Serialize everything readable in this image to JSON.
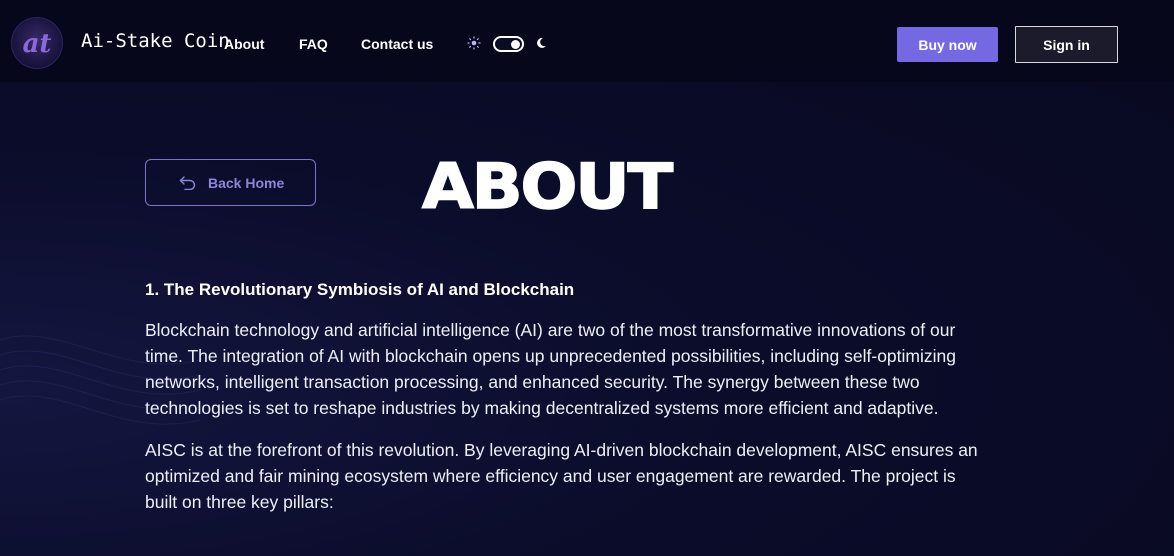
{
  "brand": {
    "name": "Ai-Stake Coin",
    "logo_monogram": "at"
  },
  "nav": {
    "items": [
      {
        "label": "About"
      },
      {
        "label": "FAQ"
      },
      {
        "label": "Contact us"
      }
    ]
  },
  "theme": {
    "mode": "dark",
    "sun_icon": "sun-icon",
    "moon_icon": "moon-icon"
  },
  "header_actions": {
    "buy_label": "Buy now",
    "signin_label": "Sign in"
  },
  "colors": {
    "accent": "#7469e2",
    "background": "#0a0b24",
    "header": "#06071a",
    "back_button_border": "#7b74c9"
  },
  "back": {
    "label": "Back Home",
    "icon": "undo-arrow-icon"
  },
  "page_title": "ABOUT",
  "section": {
    "heading": "1. The Revolutionary Symbiosis of AI and Blockchain",
    "paragraphs": [
      "Blockchain technology and artificial intelligence (AI) are two of the most transformative innovations of our time. The integration of AI with blockchain opens up unprecedented possibilities, including self-optimizing networks, intelligent transaction processing, and enhanced security. The synergy between these two technologies is set to reshape industries by making decentralized systems more efficient and adaptive.",
      "AISC is at the forefront of this revolution. By leveraging AI-driven blockchain development, AISC ensures an optimized and fair mining ecosystem where efficiency and user engagement are rewarded. The project is built on three key pillars:"
    ]
  }
}
